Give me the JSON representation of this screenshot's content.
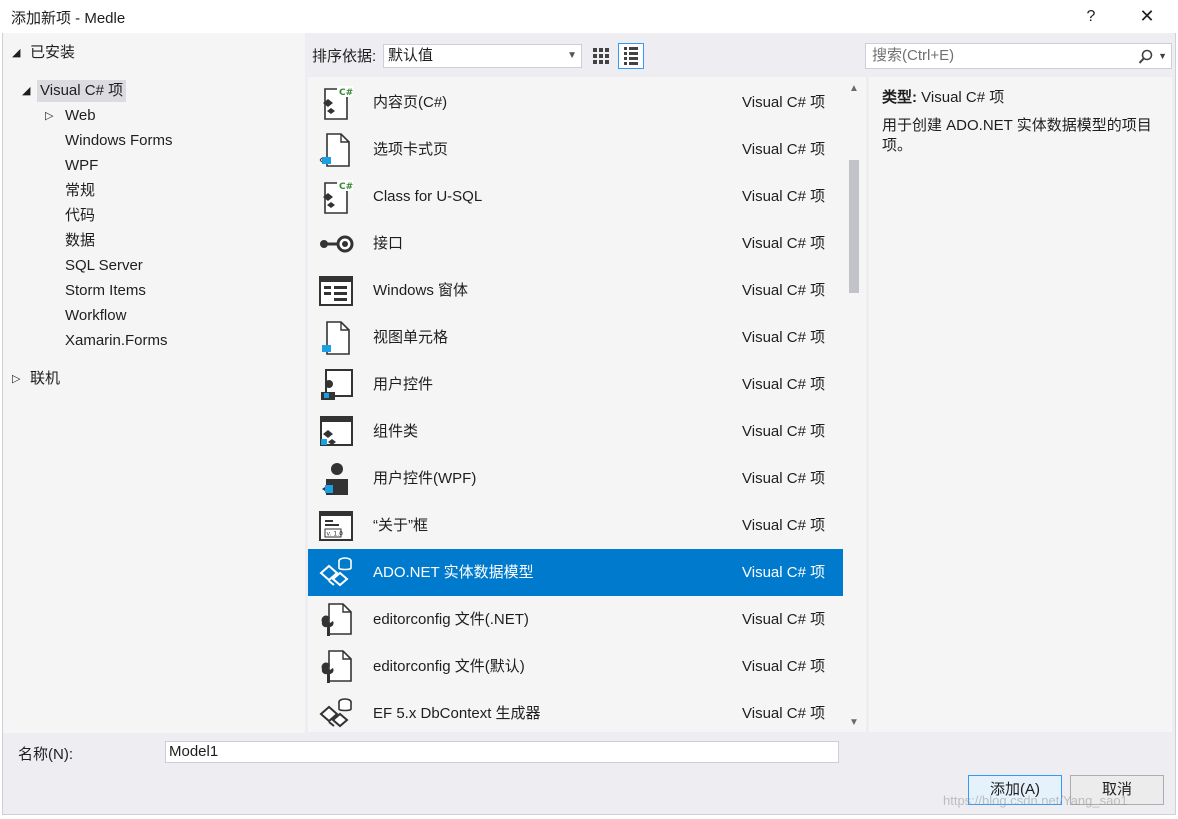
{
  "window": {
    "title": "添加新项 - Medle",
    "help_label": "?",
    "close_label": "✕"
  },
  "tree": {
    "installed": "已安装",
    "installed_arrow": "◢",
    "visual_csharp": "Visual C# 项",
    "visual_csharp_arrow": "◢",
    "web_arrow": "▷",
    "children": [
      "Web",
      "Windows Forms",
      "WPF",
      "常规",
      "代码",
      "数据",
      "SQL Server",
      "Storm Items",
      "Workflow",
      "Xamarin.Forms"
    ],
    "online": "联机",
    "online_arrow": "▷"
  },
  "toolbar": {
    "sort_label": "排序依据:",
    "sort_value": "默认值",
    "search_placeholder": "搜索(Ctrl+E)"
  },
  "items": [
    {
      "name": "内容页(C#)",
      "category": "Visual C# 项",
      "icon": "csharp-page-icon"
    },
    {
      "name": "选项卡式页",
      "category": "Visual C# 项",
      "icon": "tabbed-page-icon"
    },
    {
      "name": "Class for U-SQL",
      "category": "Visual C# 项",
      "icon": "csharp-class-icon"
    },
    {
      "name": "接口",
      "category": "Visual C# 项",
      "icon": "interface-icon"
    },
    {
      "name": "Windows 窗体",
      "category": "Visual C# 项",
      "icon": "windows-form-icon"
    },
    {
      "name": "视图单元格",
      "category": "Visual C# 项",
      "icon": "view-cell-icon"
    },
    {
      "name": "用户控件",
      "category": "Visual C# 项",
      "icon": "user-control-icon"
    },
    {
      "name": "组件类",
      "category": "Visual C# 项",
      "icon": "component-class-icon"
    },
    {
      "name": "用户控件(WPF)",
      "category": "Visual C# 项",
      "icon": "user-control-wpf-icon"
    },
    {
      "name": "“关于”框",
      "category": "Visual C# 项",
      "icon": "about-box-icon"
    },
    {
      "name": "ADO.NET 实体数据模型",
      "category": "Visual C# 项",
      "icon": "entity-model-icon"
    },
    {
      "name": "editorconfig 文件(.NET)",
      "category": "Visual C# 项",
      "icon": "editorconfig-icon"
    },
    {
      "name": "editorconfig 文件(默认)",
      "category": "Visual C# 项",
      "icon": "editorconfig-icon"
    },
    {
      "name": "EF 5.x DbContext 生成器",
      "category": "Visual C# 项",
      "icon": "dbcontext-generator-icon"
    }
  ],
  "selected_item": "ADO.NET 实体数据模型",
  "description": {
    "type_label": "类型:",
    "type_value": "Visual C# 项",
    "text": "用于创建 ADO.NET 实体数据模型的项目项。"
  },
  "name_field": {
    "label": "名称(N):",
    "value": "Model1"
  },
  "buttons": {
    "add": "添加(A)",
    "cancel": "取消"
  },
  "watermark": "https://blog.csdn.net/Yang_sao1",
  "colors": {
    "selection": "#007acc",
    "dialog_bg": "#eeeef2",
    "panel_bg": "#f5f5f5"
  }
}
